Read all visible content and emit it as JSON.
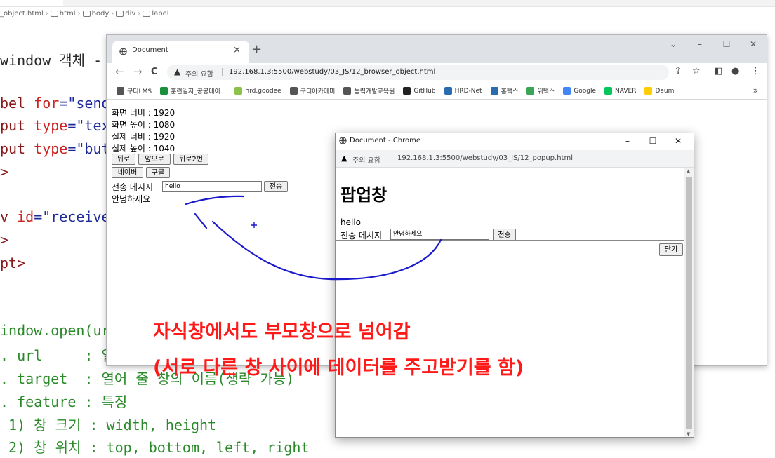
{
  "editor": {
    "breadcrumb": [
      "_object.html",
      "html",
      "body",
      "div",
      "label"
    ],
    "lines": [
      {
        "segments": [
          {
            "t": "window 객체 -",
            "c": "c-text"
          }
        ]
      },
      {
        "segments": [
          {
            "t": "bel ",
            "c": "c-tag"
          },
          {
            "t": "for",
            "c": "c-attr"
          },
          {
            "t": "=\"send",
            "c": "c-str"
          }
        ]
      },
      {
        "segments": [
          {
            "t": "put ",
            "c": "c-tag"
          },
          {
            "t": "type",
            "c": "c-attr"
          },
          {
            "t": "=\"tex",
            "c": "c-str"
          }
        ]
      },
      {
        "segments": [
          {
            "t": "put ",
            "c": "c-tag"
          },
          {
            "t": "type",
            "c": "c-attr"
          },
          {
            "t": "=\"but",
            "c": "c-str"
          }
        ]
      },
      {
        "segments": [
          {
            "t": ">",
            "c": "c-tag"
          }
        ]
      },
      {
        "segments": [
          {
            "t": "v ",
            "c": "c-tag"
          },
          {
            "t": "id",
            "c": "c-attr"
          },
          {
            "t": "=\"receive",
            "c": "c-str"
          }
        ]
      },
      {
        "segments": [
          {
            "t": ">",
            "c": "c-tag"
          }
        ]
      },
      {
        "segments": [
          {
            "t": "pt>",
            "c": "c-tag"
          }
        ]
      },
      {
        "segments": [
          {
            "t": "indow.open(ur",
            "c": "c-com"
          }
        ]
      },
      {
        "segments": [
          {
            "t": ". url     : 열",
            "c": "c-com"
          }
        ]
      },
      {
        "segments": [
          {
            "t": ". target  : 열어 줄 창의 이름(생략 가능)",
            "c": "c-com"
          }
        ]
      },
      {
        "segments": [
          {
            "t": ". feature : 특징",
            "c": "c-com"
          }
        ]
      },
      {
        "segments": [
          {
            "t": " 1) 창 크기 : width, height",
            "c": "c-com"
          }
        ]
      },
      {
        "segments": [
          {
            "t": " 2) 창 위치 : top, bottom, left, right",
            "c": "c-com"
          }
        ]
      }
    ]
  },
  "browser": {
    "tab_title": "Document",
    "tab_close": "×",
    "new_tab": "+",
    "win_controls": [
      "⌄",
      "–",
      "☐",
      "✕"
    ],
    "nav": [
      "←",
      "→",
      "C"
    ],
    "security_label": "주의 요함",
    "url": "192.168.1.3:5500/webstudy/03_JS/12_browser_object.html",
    "toolbar_right": [
      "⇪",
      "☆",
      "◧",
      "●",
      "⋮"
    ],
    "bookmarks": [
      {
        "label": "구디LMS",
        "color": "#555555"
      },
      {
        "label": "훈련일지_공공데이...",
        "color": "#1a8f3c"
      },
      {
        "label": "hrd.goodee",
        "color": "#8bc34a"
      },
      {
        "label": "구디아카데미",
        "color": "#555555"
      },
      {
        "label": "능력개발교육원",
        "color": "#555555"
      },
      {
        "label": "GitHub",
        "color": "#222222"
      },
      {
        "label": "HRD-Net",
        "color": "#2b6cb0"
      },
      {
        "label": "홈택스",
        "color": "#2b6cb0"
      },
      {
        "label": "위택스",
        "color": "#3aa655"
      },
      {
        "label": "Google",
        "color": "#4285f4"
      },
      {
        "label": "NAVER",
        "color": "#03c75a"
      },
      {
        "label": "Daum",
        "color": "#ffcd00"
      }
    ],
    "bookmarks_more": "»",
    "page": {
      "screen_width": "화면 너비 : 1920",
      "screen_height": "화면 높이 : 1080",
      "actual_width": "실제 너비 : 1920",
      "actual_height": "실제 높이 : 1040",
      "back_button": "뒤로",
      "forward_button": "앞으로",
      "back2_button": "뒤로2번",
      "naver_button": "네이버",
      "google_button": "구글",
      "send_label": "전송 메시지",
      "send_value": "hello",
      "send_button": "전송",
      "received": "안녕하세요"
    }
  },
  "popup": {
    "title": "Document - Chrome",
    "controls": [
      "–",
      "☐",
      "✕"
    ],
    "security_label": "주의 요함",
    "url": "192.168.1.3:5500/webstudy/03_JS/12_popup.html",
    "heading": "팝업창",
    "received": "hello",
    "send_label": "전송 메시지",
    "send_value": "안녕하세요",
    "send_button": "전송",
    "close_button": "닫기"
  },
  "annotations": {
    "note_line1": "자식창에서도 부모창으로 넘어감",
    "note_line2": "(서로 다른 창 사이에 데이터를 주고받기를 함)",
    "note_color": "#ff1a1a",
    "stroke_color": "#1a1acc"
  }
}
